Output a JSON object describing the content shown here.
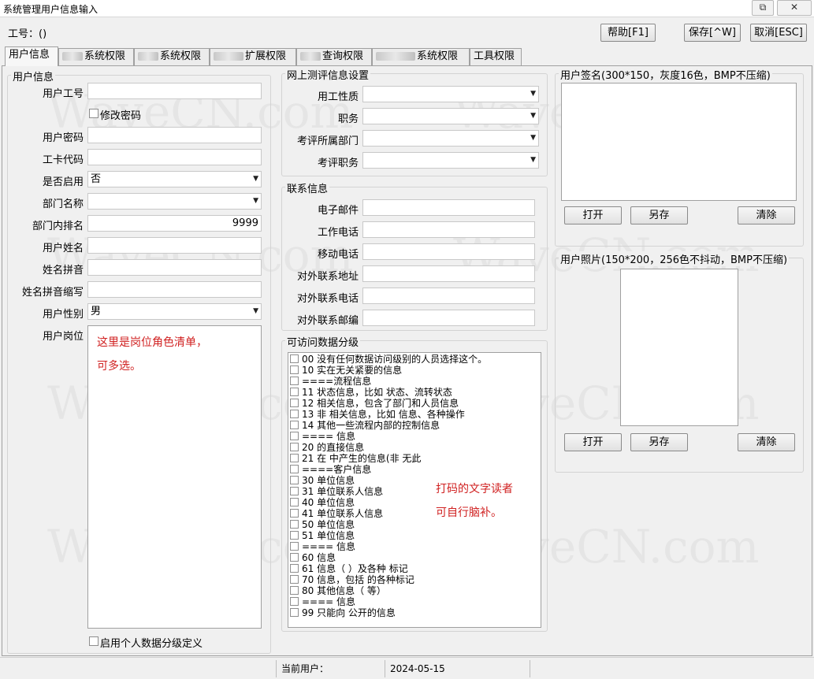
{
  "window": {
    "title": "系统管理用户信息输入",
    "btn_min": "⧉",
    "btn_close": "✕"
  },
  "header": {
    "emp_no_label": "工号：()"
  },
  "toolbar": {
    "help": "帮助[F1]",
    "save": "保存[^W]",
    "cancel": "取消[ESC]"
  },
  "tabs": [
    "用户信息",
    "系统权限",
    "系统权限",
    "扩展权限",
    "查询权限",
    "系统权限",
    "工具权限"
  ],
  "user_info": {
    "title": "用户信息",
    "user_id": {
      "label": "用户工号",
      "value": ""
    },
    "change_pwd": "修改密码",
    "password": {
      "label": "用户密码",
      "value": ""
    },
    "card_code": {
      "label": "工卡代码",
      "value": ""
    },
    "enabled": {
      "label": "是否启用",
      "value": "否"
    },
    "dept": {
      "label": "部门名称",
      "value": ""
    },
    "dept_rank": {
      "label": "部门内排名",
      "value": "9999"
    },
    "name": {
      "label": "用户姓名",
      "value": ""
    },
    "pinyin": {
      "label": "姓名拼音",
      "value": ""
    },
    "pinyin_abbr": {
      "label": "姓名拼音缩写",
      "value": ""
    },
    "gender": {
      "label": "用户性别",
      "value": "男"
    },
    "post": {
      "label": "用户岗位",
      "note1": "这里是岗位角色清单，",
      "note2": "可多选。"
    },
    "personal_grade": "启用个人数据分级定义"
  },
  "eval": {
    "title": "网上测评信息设置",
    "employment": "用工性质",
    "duty": "职务",
    "eval_dept": "考评所属部门",
    "eval_duty": "考评职务"
  },
  "contact": {
    "title": "联系信息",
    "email": "电子邮件",
    "work_phone": "工作电话",
    "mobile": "移动电话",
    "address": "对外联系地址",
    "phone": "对外联系电话",
    "postcode": "对外联系邮编"
  },
  "data_grade": {
    "title": "可访问数据分级",
    "items": [
      "00 没有任何数据访问级别的人员选择这个。",
      "10 实在无关紧要的信息",
      "====流程信息",
      "11 状态信息，比如      状态、流转状态",
      "12       相关信息，包含了部门和人员信息",
      "13 非      相关信息，比如       信息、各种操作",
      "14 其他一些流程内部的控制信息",
      "====      信息",
      "20       的直接信息",
      "21       在          中产生的信息(非          无此",
      "====客户信息",
      "30       单位信息",
      "31       单位联系人信息",
      "40       单位信息",
      "41       单位联系人信息",
      "50       单位信息",
      "51       单位信息",
      "====      信息",
      "60            信息",
      "61            信息（      ）及各种      标记",
      "70            信息，包括      的各种标记",
      "80 其他信息（          等）",
      "====        信息",
      "99 只能向               公开的信息"
    ],
    "note1": "打码的文字读者",
    "note2": "可自行脑补。"
  },
  "signature": {
    "title": "用户签名(300*150，灰度16色，BMP不压缩)",
    "open": "打开",
    "save_as": "另存",
    "clear": "清除"
  },
  "photo": {
    "title": "用户照片(150*200，256色不抖动，BMP不压缩)",
    "open": "打开",
    "save_as": "另存",
    "clear": "清除"
  },
  "status": {
    "current_user_label": "当前用户：",
    "date": "2024-05-15"
  },
  "watermark": "WaveCN.com"
}
